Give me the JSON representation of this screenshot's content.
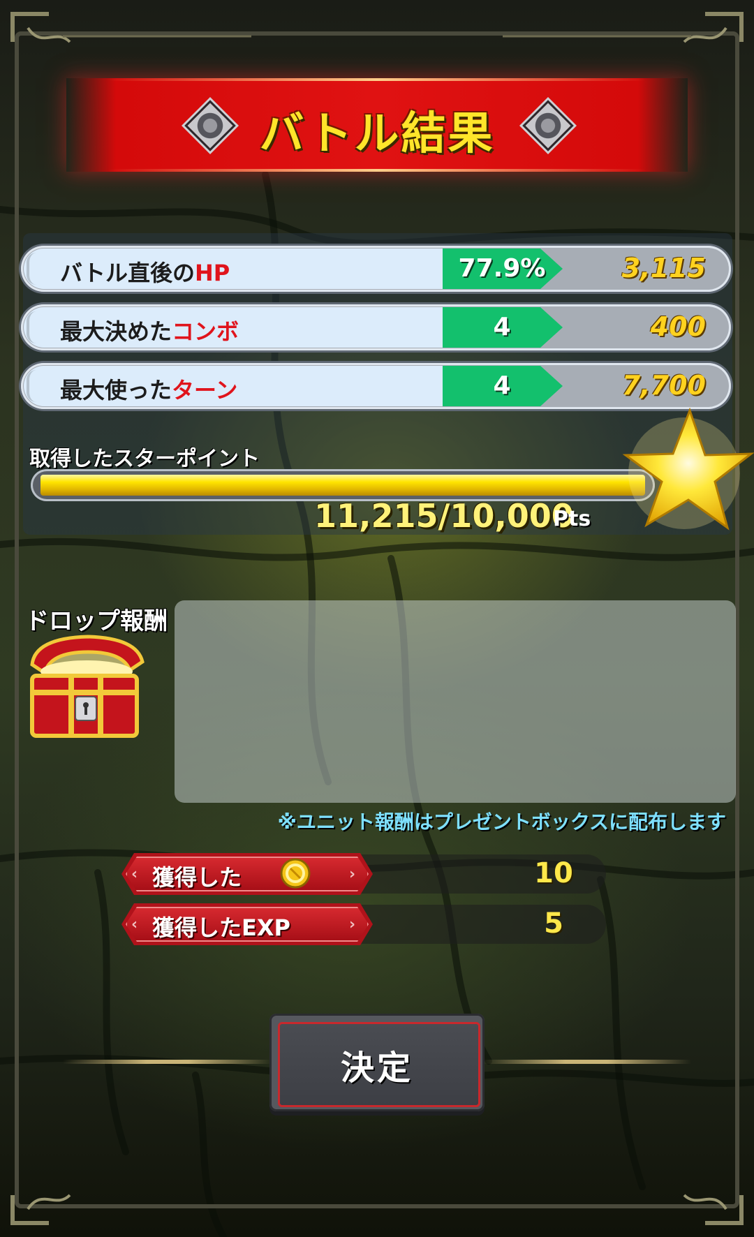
{
  "title": "バトル結果",
  "stats": [
    {
      "label_prefix": "バトル直後の",
      "label_highlight": "HP",
      "value": "77.9%",
      "points": "3,115"
    },
    {
      "label_prefix": "最大決めた",
      "label_highlight": "コンボ",
      "value": "4",
      "points": "400"
    },
    {
      "label_prefix": "最大使った",
      "label_highlight": "ターン",
      "value": "4",
      "points": "7,700"
    }
  ],
  "star_points": {
    "title": "取得したスターポイント",
    "value": "11,215/10,000",
    "unit": "Pts",
    "progress": 1.0
  },
  "drop": {
    "title": "ドロップ報酬",
    "note": "※ユニット報酬はプレゼントボックスに配布します"
  },
  "gains": [
    {
      "label": "獲得した",
      "icon": "gold-coin-icon",
      "value": "10"
    },
    {
      "label": "獲得したEXP",
      "value": "5"
    }
  ],
  "confirm_button": "決定",
  "colors": {
    "banner_red": "#e01212",
    "title_yellow": "#ffe52a",
    "value_green": "#13c06d",
    "highlight_red": "#e0141c",
    "note_cyan": "#7ee0ff"
  }
}
